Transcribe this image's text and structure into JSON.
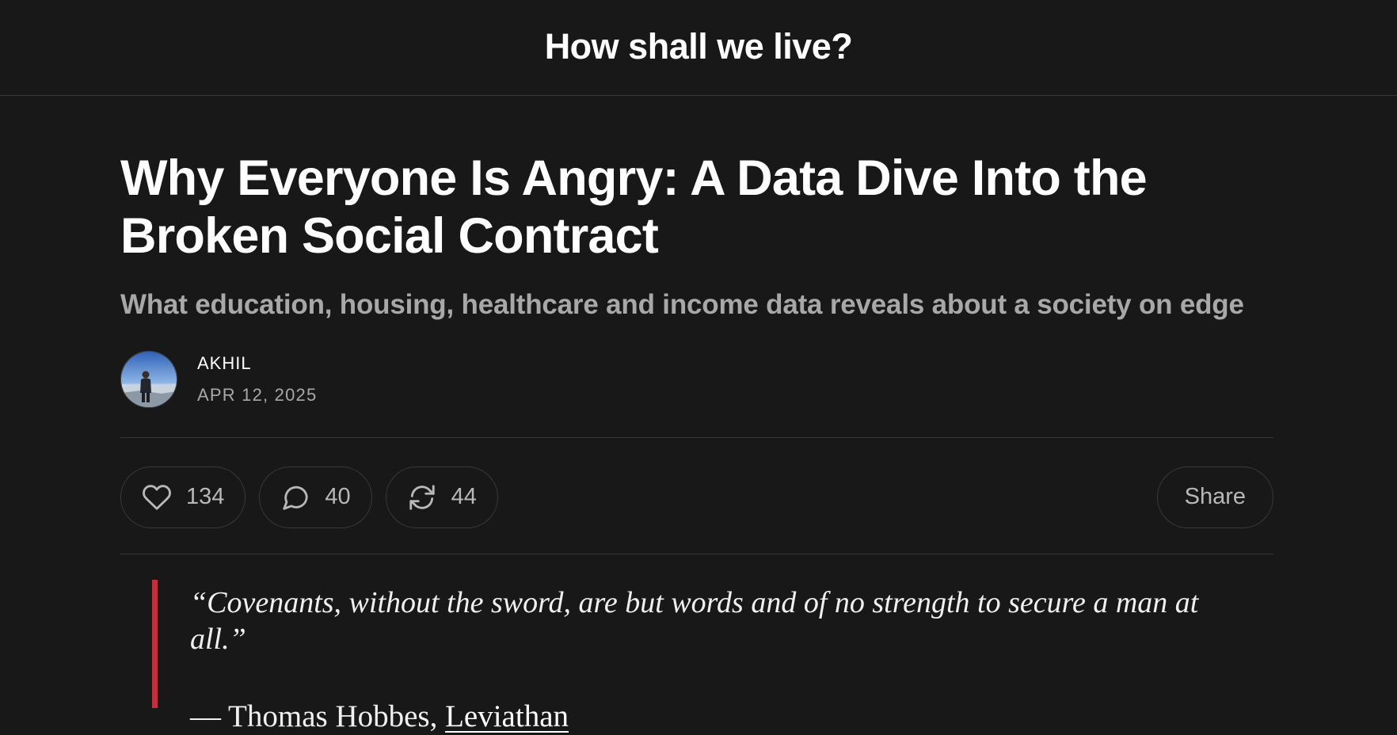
{
  "header": {
    "site_title": "How shall we live?"
  },
  "post": {
    "title": "Why Everyone Is Angry: A Data Dive Into the Broken Social Contract",
    "subtitle": "What education, housing, healthcare and income data reveals about a society on edge",
    "author": "AKHIL",
    "date": "APR 12, 2025"
  },
  "actions": {
    "likes": "134",
    "comments": "40",
    "restacks": "44",
    "share_label": "Share"
  },
  "quote": {
    "text": "“Covenants, without the sword, are but words and of no strength to secure a man at all.”",
    "attribution_prefix": "— Thomas Hobbes, ",
    "attribution_link": "Leviathan"
  },
  "colors": {
    "background": "#181818",
    "text": "#ffffff",
    "muted": "#a8a8a8",
    "divider": "#363636",
    "quote_accent": "#c0303e"
  },
  "icons": {
    "like": "heart-icon",
    "comment": "comment-bubble-icon",
    "restack": "restack-icon"
  }
}
